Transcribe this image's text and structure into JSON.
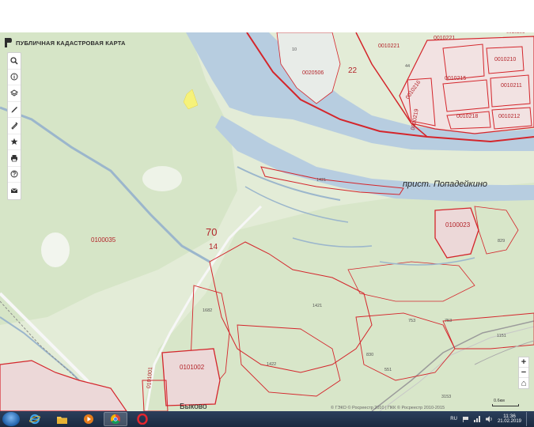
{
  "app": {
    "title": "ПУБЛИЧНАЯ КАДАСТРОВАЯ КАРТА"
  },
  "toolbar": {
    "tools": [
      {
        "name": "search-icon"
      },
      {
        "name": "info-icon"
      },
      {
        "name": "layers-icon"
      },
      {
        "name": "pencil-icon"
      },
      {
        "name": "ruler-pen-icon"
      },
      {
        "name": "star-icon"
      },
      {
        "name": "print-icon"
      },
      {
        "name": "help-icon"
      },
      {
        "name": "mail-icon"
      }
    ]
  },
  "zoom": {
    "plus": "+",
    "minus": "−",
    "home": "⌂"
  },
  "map": {
    "labels": {
      "pristan": "прист. Попадейкино",
      "block70": "70",
      "block14": "14",
      "block22": "22",
      "bykovo": "Быково",
      "c0100035": "0100035",
      "c0100023": "0100023",
      "c0101002": "0101002",
      "c0101001": "0101001",
      "c0020506": "0020506",
      "c0010221": "0010221",
      "c0010221b": "0010221",
      "c0010216": "0010216",
      "c0010215": "0010215",
      "c0010210": "0010210",
      "c0010211": "0010211",
      "c0010218": "0010218",
      "c0010212": "0010212",
      "c0010219": "0010219",
      "c0010206": "0010206",
      "n10": "10",
      "n44": "44",
      "n1421a": "1421",
      "n1421b": "1421",
      "n1682": "1682",
      "n1422": "1422",
      "n830": "830",
      "n753a": "753",
      "n753b": "753",
      "n1151": "1151",
      "n829": "829",
      "n3153": "3153",
      "n551": "551"
    },
    "colors": {
      "water": "#b7cde0",
      "land": "#e3ecd7",
      "forest": "#cfe0c0",
      "boundary": "#d4252b",
      "road": "#f5f5f5"
    }
  },
  "footer": {
    "copyright": "© ГЭКО © Росреестр 2010 | ПКК © Росреестр 2010-2015",
    "scale": "0.6км"
  },
  "taskbar": {
    "apps": [
      {
        "name": "ie-icon"
      },
      {
        "name": "explorer-icon"
      },
      {
        "name": "media-player-icon"
      },
      {
        "name": "chrome-icon"
      },
      {
        "name": "opera-icon"
      }
    ],
    "lang": "RU",
    "time": "11:36",
    "date": "21.02.2019"
  }
}
